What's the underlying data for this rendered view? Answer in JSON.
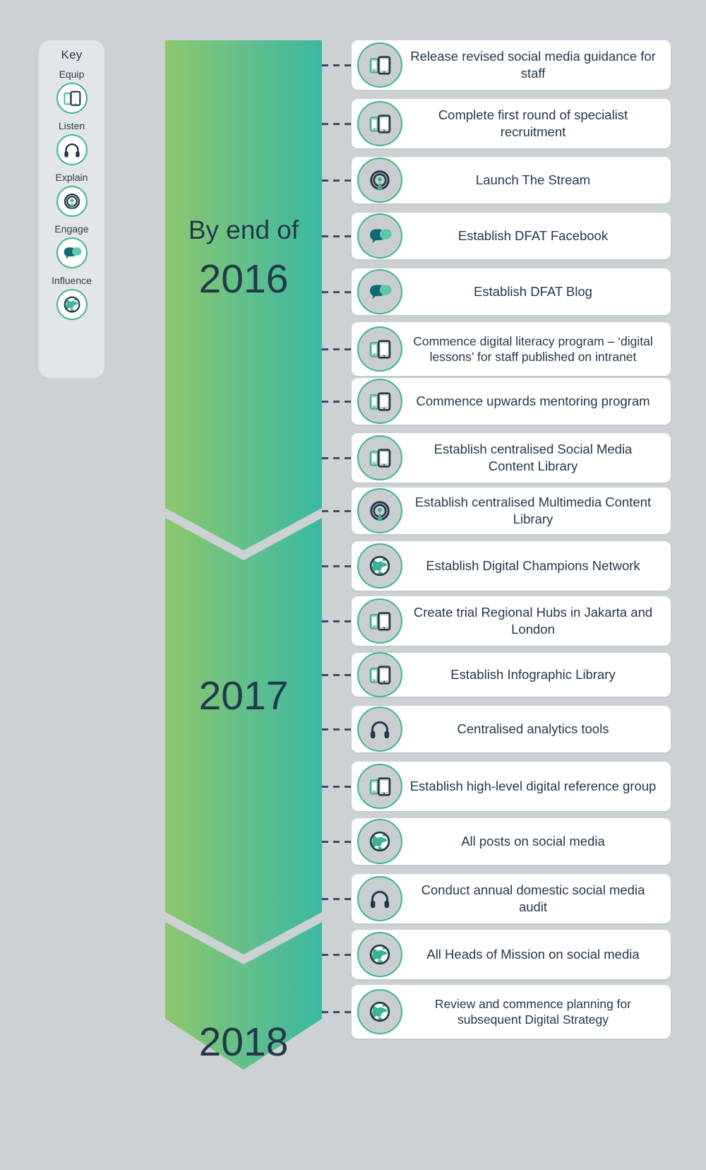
{
  "colors": {
    "background": "#ccd1d4",
    "banner_gradient_start": "#8dc76c",
    "banner_gradient_end": "#3bb8a2",
    "accent_teal": "#3cb494",
    "dark_navy": "#24384c",
    "icon_disc": "#c9ced1",
    "card_white": "#ffffff",
    "key_panel": "#e2e6e8"
  },
  "key": {
    "title": "Key",
    "items": [
      {
        "label": "Equip",
        "icon": "devices-icon"
      },
      {
        "label": "Listen",
        "icon": "headphones-icon"
      },
      {
        "label": "Explain",
        "icon": "broadcast-icon"
      },
      {
        "label": "Engage",
        "icon": "speech-bubbles-icon"
      },
      {
        "label": "Influence",
        "icon": "globe-icon"
      }
    ]
  },
  "timeline": {
    "phases": [
      {
        "prefix": "By end of",
        "year": "2016"
      },
      {
        "prefix": "",
        "year": "2017"
      },
      {
        "prefix": "",
        "year": "2018"
      }
    ]
  },
  "milestones": [
    {
      "text": "Release revised social media guidance for staff",
      "icon": "devices-icon",
      "lines": 2
    },
    {
      "text": "Complete first round of specialist recruitment",
      "icon": "devices-icon",
      "lines": 2
    },
    {
      "text": "Launch The Stream",
      "icon": "broadcast-icon",
      "lines": 1
    },
    {
      "text": "Establish DFAT Facebook",
      "icon": "speech-bubbles-icon",
      "lines": 1
    },
    {
      "text": "Establish DFAT Blog",
      "icon": "speech-bubbles-icon",
      "lines": 1
    },
    {
      "text": "Commence digital literacy program – ‘digital lessons’ for staff published on intranet",
      "icon": "devices-icon",
      "lines": 3
    },
    {
      "text": "Commence upwards mentoring program",
      "icon": "devices-icon",
      "lines": 2
    },
    {
      "text": "Establish centralised Social Media Content Library",
      "icon": "devices-icon",
      "lines": 2
    },
    {
      "text": "Establish centralised Multimedia Content Library",
      "icon": "broadcast-icon",
      "lines": 2
    },
    {
      "text": "Establish Digital Champions Network",
      "icon": "globe-icon",
      "lines": 2
    },
    {
      "text": "Create trial Regional Hubs in Jakarta and London",
      "icon": "devices-icon",
      "lines": 2
    },
    {
      "text": "Establish Infographic Library",
      "icon": "devices-icon",
      "lines": 1
    },
    {
      "text": "Centralised analytics tools",
      "icon": "headphones-icon",
      "lines": 1
    },
    {
      "text": "Establish high-level digital reference group",
      "icon": "devices-icon",
      "lines": 2
    },
    {
      "text": "All posts on social media",
      "icon": "globe-icon",
      "lines": 1
    },
    {
      "text": "Conduct annual domestic social media audit",
      "icon": "headphones-icon",
      "lines": 2
    },
    {
      "text": "All Heads of Mission on social media",
      "icon": "globe-icon",
      "lines": 2
    },
    {
      "text": "Review and commence planning for subsequent Digital Strategy",
      "icon": "globe-icon",
      "lines": 3
    }
  ]
}
